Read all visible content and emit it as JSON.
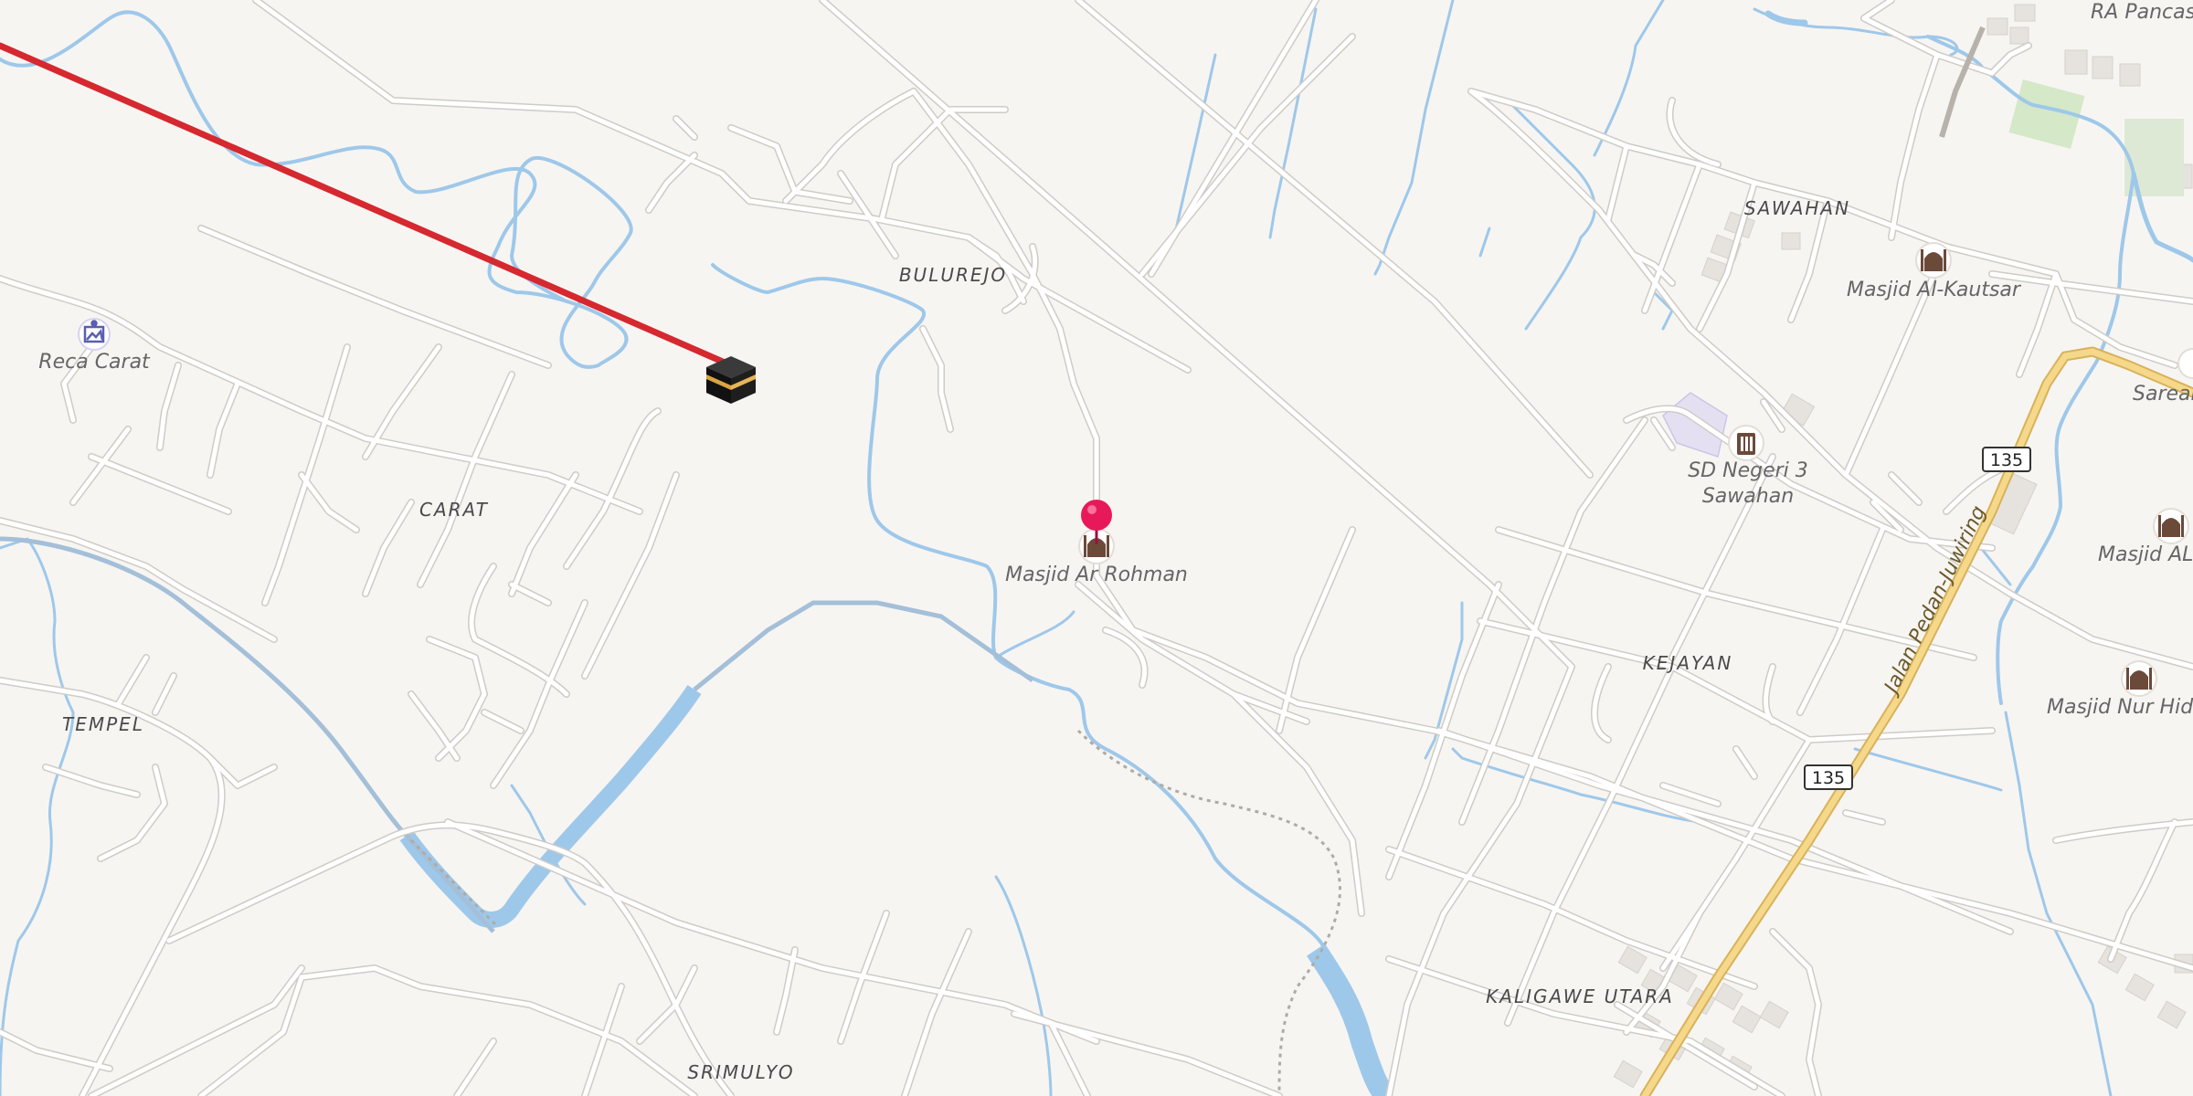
{
  "map": {
    "colors": {
      "land": "#f7f5f2",
      "road": "#d6d3cf",
      "road_casing": "#ffffff",
      "highway": "#f2ce7a",
      "highway_casing": "#d8b25a",
      "water": "#9ec8ea",
      "route": "#d6282f",
      "pin": "#e8195a",
      "poi_icon": "#6b4a3a",
      "school": "#e4e0f2",
      "park": "#d5e8c8",
      "building": "#e6e2dd"
    },
    "places": [
      {
        "name": "BULUREJO"
      },
      {
        "name": "CARAT"
      },
      {
        "name": "TEMPEL"
      },
      {
        "name": "SRIMULYO"
      },
      {
        "name": "SAWAHAN"
      },
      {
        "name": "KEJAYAN"
      },
      {
        "name": "KALIGAWE UTARA"
      }
    ],
    "pois": [
      {
        "name": "Reca Carat",
        "icon": "monument-icon"
      },
      {
        "name": "Masjid Ar Rohman",
        "icon": "mosque-icon"
      },
      {
        "name": "Masjid Al-Kautsar",
        "icon": "mosque-icon"
      },
      {
        "name_line1": "SD Negeri 3",
        "name_line2": "Sawahan",
        "icon": "school-icon"
      },
      {
        "name": "Masjid AL",
        "icon": "mosque-icon"
      },
      {
        "name": "Masjid Nur Hida",
        "icon": "mosque-icon"
      },
      {
        "name": "Sarean",
        "icon": "cemetery-icon"
      },
      {
        "name": "RA Pancasi",
        "icon": ""
      }
    ],
    "road_label": "Jalan Pedan-Juwiring",
    "shields": [
      "135",
      "135"
    ],
    "markers": {
      "kaaba": {
        "icon": "kaaba-icon"
      },
      "location_pin": {
        "icon": "location-pin-icon"
      }
    }
  }
}
